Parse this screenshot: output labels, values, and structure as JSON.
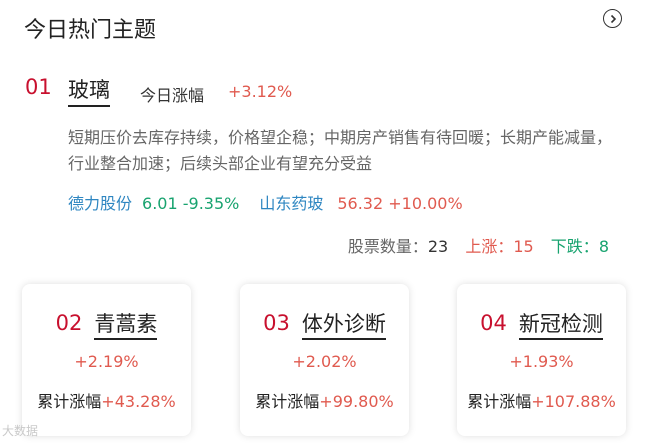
{
  "header": {
    "title": "今日热门主题",
    "more_icon": "chevron-right-circle-icon"
  },
  "featured": {
    "rank": "01",
    "name": "玻璃",
    "gain_label": "今日涨幅",
    "gain_value": "+3.12%",
    "description": "短期压价去库存持续，价格望企稳；中期房产销售有待回暖；长期产能减量，行业整合加速；后续头部企业有望充分受益",
    "stocks": [
      {
        "name": "德力股份",
        "price": "6.01",
        "change": "-9.35%"
      },
      {
        "name": "山东药玻",
        "price": "56.32",
        "change": "+10.00%"
      }
    ],
    "counts": {
      "total_label": "股票数量：",
      "total": "23",
      "up_label": "上涨：",
      "up": "15",
      "down_label": "下跌：",
      "down": "8"
    }
  },
  "cards": [
    {
      "rank": "02",
      "name": "青蒿素",
      "pct": "+2.19%",
      "cum_label": "累计涨幅",
      "cum_value": "+43.28%"
    },
    {
      "rank": "03",
      "name": "体外诊断",
      "pct": "+2.02%",
      "cum_label": "累计涨幅",
      "cum_value": "+99.80%"
    },
    {
      "rank": "04",
      "name": "新冠检测",
      "pct": "+1.93%",
      "cum_label": "累计涨幅",
      "cum_value": "+107.88%"
    }
  ],
  "watermark": "大数据",
  "colors": {
    "rank": "#c8102e",
    "up": "#e05a4f",
    "down": "#18a36f",
    "link": "#2e86c1"
  }
}
